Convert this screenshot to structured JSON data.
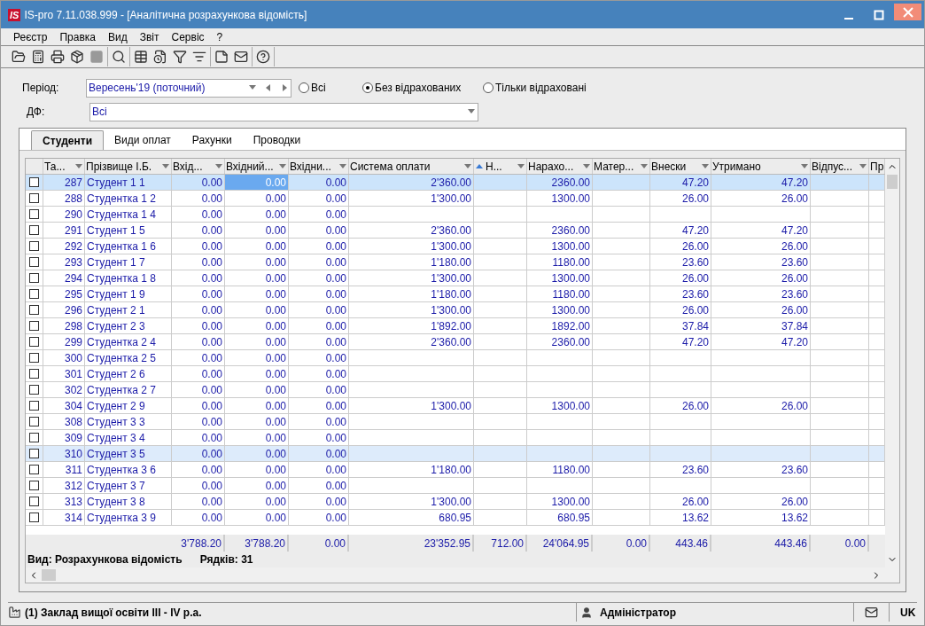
{
  "window": {
    "logo": "IS",
    "title": "IS-pro 7.11.038.999 - [Аналітична розрахункова відомість]"
  },
  "menu": [
    "Реєстр",
    "Правка",
    "Вид",
    "Звіт",
    "Сервіс",
    "?"
  ],
  "filters": {
    "period_label": "Період:",
    "period_value": "Вересень'19 (поточний)",
    "options": [
      {
        "label": "Всі",
        "selected": false
      },
      {
        "label": "Без відрахованих",
        "selected": true
      },
      {
        "label": "Тільки відраховані",
        "selected": false
      }
    ],
    "df_label": "ДФ:",
    "df_value": "Всі"
  },
  "tabs": [
    {
      "label": "Студенти",
      "selected": true
    },
    {
      "label": "Види оплат",
      "selected": false
    },
    {
      "label": "Рахунки",
      "selected": false
    },
    {
      "label": "Проводки",
      "selected": false
    }
  ],
  "table": {
    "columns": [
      {
        "label": "Та...",
        "kind": "number",
        "menu": true,
        "sorted": false,
        "focused": false
      },
      {
        "label": "Прізвище І.Б.",
        "kind": "text",
        "menu": true,
        "sorted": false,
        "focused": false
      },
      {
        "label": "Вхід...",
        "kind": "number",
        "menu": true,
        "sorted": false,
        "focused": false
      },
      {
        "label": "Вхідний...",
        "kind": "number",
        "menu": true,
        "sorted": false,
        "focused": true
      },
      {
        "label": "Вхідни...",
        "kind": "number",
        "menu": true,
        "sorted": false,
        "focused": false
      },
      {
        "label": "Система оплати",
        "kind": "number",
        "menu": true,
        "sorted": false,
        "focused": false
      },
      {
        "label": "Н...",
        "kind": "number",
        "menu": true,
        "sorted": true,
        "focused": false
      },
      {
        "label": "Нарахо...",
        "kind": "number",
        "menu": true,
        "sorted": false,
        "focused": false
      },
      {
        "label": "Матер...",
        "kind": "number",
        "menu": true,
        "sorted": false,
        "focused": false
      },
      {
        "label": "Внески",
        "kind": "number",
        "menu": true,
        "sorted": false,
        "focused": false
      },
      {
        "label": "Утримано",
        "kind": "number",
        "menu": true,
        "sorted": false,
        "focused": false
      },
      {
        "label": "Відпус...",
        "kind": "number",
        "menu": true,
        "sorted": false,
        "focused": false
      },
      {
        "label": "Пр",
        "kind": "number",
        "sorted": false,
        "focused": false
      }
    ],
    "rows": [
      {
        "checked": false,
        "selected": true,
        "hovered": false,
        "column_1": "287",
        "column_2": "Студент 1 1",
        "column_3": "0.00",
        "column_4": "0.00",
        "column_5": "0.00",
        "column_6": "2'360.00",
        "column_8": "2360.00",
        "column_10": "47.20",
        "column_11": "47.20"
      },
      {
        "checked": false,
        "selected": false,
        "hovered": false,
        "column_1": "288",
        "column_2": "Студентка 1 2",
        "column_3": "0.00",
        "column_4": "0.00",
        "column_5": "0.00",
        "column_6": "1'300.00",
        "column_8": "1300.00",
        "column_10": "26.00",
        "column_11": "26.00"
      },
      {
        "checked": false,
        "selected": false,
        "hovered": false,
        "column_1": "290",
        "column_2": "Студентка 1 4",
        "column_3": "0.00",
        "column_4": "0.00",
        "column_5": "0.00"
      },
      {
        "checked": false,
        "selected": false,
        "hovered": false,
        "column_1": "291",
        "column_2": "Студент 1 5",
        "column_3": "0.00",
        "column_4": "0.00",
        "column_5": "0.00",
        "column_6": "2'360.00",
        "column_8": "2360.00",
        "column_10": "47.20",
        "column_11": "47.20"
      },
      {
        "checked": false,
        "selected": false,
        "hovered": false,
        "column_1": "292",
        "column_2": "Студентка 1 6",
        "column_3": "0.00",
        "column_4": "0.00",
        "column_5": "0.00",
        "column_6": "1'300.00",
        "column_8": "1300.00",
        "column_10": "26.00",
        "column_11": "26.00"
      },
      {
        "checked": false,
        "selected": false,
        "hovered": false,
        "column_1": "293",
        "column_2": "Студент 1 7",
        "column_3": "0.00",
        "column_4": "0.00",
        "column_5": "0.00",
        "column_6": "1'180.00",
        "column_8": "1180.00",
        "column_10": "23.60",
        "column_11": "23.60"
      },
      {
        "checked": false,
        "selected": false,
        "hovered": false,
        "column_1": "294",
        "column_2": "Студентка 1 8",
        "column_3": "0.00",
        "column_4": "0.00",
        "column_5": "0.00",
        "column_6": "1'300.00",
        "column_8": "1300.00",
        "column_10": "26.00",
        "column_11": "26.00"
      },
      {
        "checked": false,
        "selected": false,
        "hovered": false,
        "column_1": "295",
        "column_2": "Студент 1 9",
        "column_3": "0.00",
        "column_4": "0.00",
        "column_5": "0.00",
        "column_6": "1'180.00",
        "column_8": "1180.00",
        "column_10": "23.60",
        "column_11": "23.60"
      },
      {
        "checked": false,
        "selected": false,
        "hovered": false,
        "column_1": "296",
        "column_2": "Студент 2 1",
        "column_3": "0.00",
        "column_4": "0.00",
        "column_5": "0.00",
        "column_6": "1'300.00",
        "column_8": "1300.00",
        "column_10": "26.00",
        "column_11": "26.00"
      },
      {
        "checked": false,
        "selected": false,
        "hovered": false,
        "column_1": "298",
        "column_2": "Студент 2 3",
        "column_3": "0.00",
        "column_4": "0.00",
        "column_5": "0.00",
        "column_6": "1'892.00",
        "column_8": "1892.00",
        "column_10": "37.84",
        "column_11": "37.84"
      },
      {
        "checked": false,
        "selected": false,
        "hovered": false,
        "column_1": "299",
        "column_2": "Студентка 2 4",
        "column_3": "0.00",
        "column_4": "0.00",
        "column_5": "0.00",
        "column_6": "2'360.00",
        "column_8": "2360.00",
        "column_10": "47.20",
        "column_11": "47.20"
      },
      {
        "checked": false,
        "selected": false,
        "hovered": false,
        "column_1": "300",
        "column_2": "Студентка 2 5",
        "column_3": "0.00",
        "column_4": "0.00",
        "column_5": "0.00"
      },
      {
        "checked": false,
        "selected": false,
        "hovered": false,
        "column_1": "301",
        "column_2": "Студент 2 6",
        "column_3": "0.00",
        "column_4": "0.00",
        "column_5": "0.00"
      },
      {
        "checked": false,
        "selected": false,
        "hovered": false,
        "column_1": "302",
        "column_2": "Студентка 2 7",
        "column_3": "0.00",
        "column_4": "0.00",
        "column_5": "0.00"
      },
      {
        "checked": false,
        "selected": false,
        "hovered": false,
        "column_1": "304",
        "column_2": "Студент 2 9",
        "column_3": "0.00",
        "column_4": "0.00",
        "column_5": "0.00",
        "column_6": "1'300.00",
        "column_8": "1300.00",
        "column_10": "26.00",
        "column_11": "26.00"
      },
      {
        "checked": false,
        "selected": false,
        "hovered": false,
        "column_1": "308",
        "column_2": "Студент 3 3",
        "column_3": "0.00",
        "column_4": "0.00",
        "column_5": "0.00"
      },
      {
        "checked": false,
        "selected": false,
        "hovered": false,
        "column_1": "309",
        "column_2": "Студент 3 4",
        "column_3": "0.00",
        "column_4": "0.00",
        "column_5": "0.00"
      },
      {
        "checked": false,
        "selected": false,
        "hovered": true,
        "column_1": "310",
        "column_2": "Студент 3 5",
        "column_3": "0.00",
        "column_4": "0.00",
        "column_5": "0.00"
      },
      {
        "checked": false,
        "selected": false,
        "hovered": false,
        "column_1": "311",
        "column_2": "Студентка 3 6",
        "column_3": "0.00",
        "column_4": "0.00",
        "column_5": "0.00",
        "column_6": "1'180.00",
        "column_8": "1180.00",
        "column_10": "23.60",
        "column_11": "23.60"
      },
      {
        "checked": false,
        "selected": false,
        "hovered": false,
        "column_1": "312",
        "column_2": "Студент 3 7",
        "column_3": "0.00",
        "column_4": "0.00",
        "column_5": "0.00"
      },
      {
        "checked": false,
        "selected": false,
        "hovered": false,
        "column_1": "313",
        "column_2": "Студент 3 8",
        "column_3": "0.00",
        "column_4": "0.00",
        "column_5": "0.00",
        "column_6": "1'300.00",
        "column_8": "1300.00",
        "column_10": "26.00",
        "column_11": "26.00"
      },
      {
        "checked": false,
        "selected": false,
        "hovered": false,
        "column_1": "314",
        "column_2": "Студентка 3 9",
        "column_3": "0.00",
        "column_4": "0.00",
        "column_5": "0.00",
        "column_6": "680.95",
        "column_8": "680.95",
        "column_10": "13.62",
        "column_11": "13.62"
      }
    ],
    "totals": {
      "column_3": "3'788.20",
      "column_4": "3'788.20",
      "column_5": "0.00",
      "column_6": "23'352.95",
      "column_7": "712.00",
      "column_8": "24'064.95",
      "column_9": "0.00",
      "column_10": "443.46",
      "column_11": "443.46",
      "column_12": "0.00"
    },
    "view_label": "Вид: Розрахункова відомість",
    "row_count": "Рядків: 31"
  },
  "status_bar": {
    "organization": "(1) Заклад вищої освіти III - IV р.а.",
    "user": "Адміністратор",
    "language": "UK"
  }
}
